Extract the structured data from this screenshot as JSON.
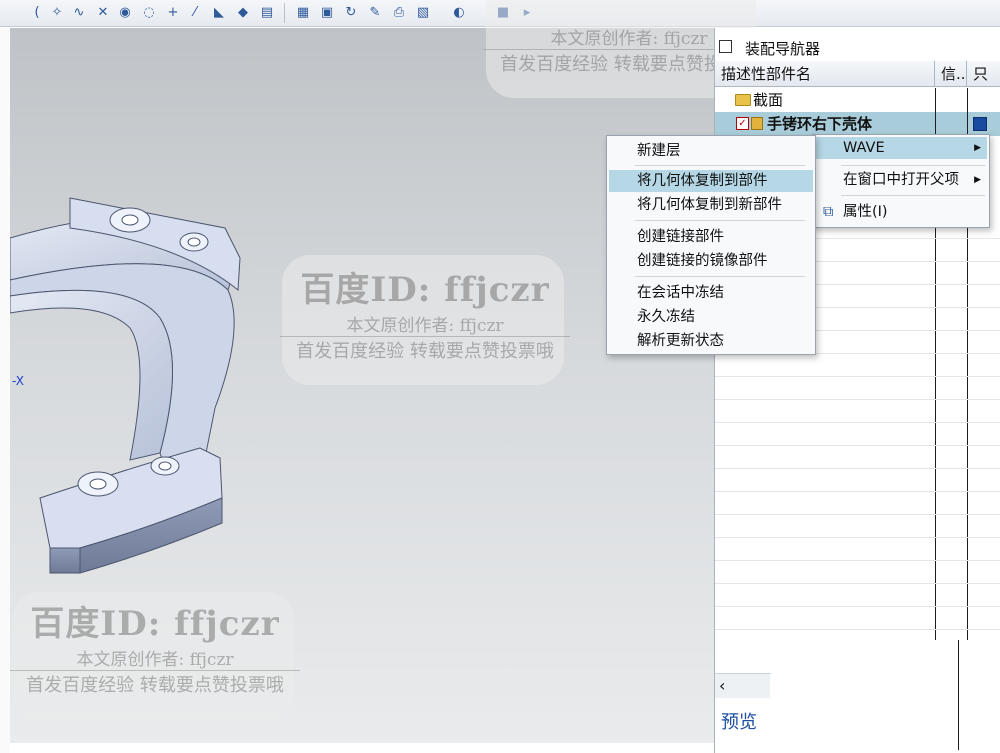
{
  "navigator": {
    "title": "装配导航器",
    "col_name": "描述性部件名",
    "col_info": "信..",
    "col_ro": "只",
    "rows": [
      {
        "label": "截面"
      },
      {
        "label": "手铐环右下壳体"
      }
    ],
    "preview": "预览"
  },
  "context_menu": {
    "items": [
      {
        "label": "新建层"
      },
      {
        "label": "将几何体复制到部件"
      },
      {
        "label": "将几何体复制到新部件"
      },
      {
        "label": "创建链接部件"
      },
      {
        "label": "创建链接的镜像部件"
      },
      {
        "label": "在会话中冻结"
      },
      {
        "label": "永久冻结"
      },
      {
        "label": "解析更新状态"
      }
    ]
  },
  "parent_menu": {
    "items": [
      {
        "label": "WAVE"
      },
      {
        "label": "在窗口中打开父项"
      },
      {
        "label": "属性(I)"
      }
    ]
  },
  "viewport": {
    "axis_label": "X"
  },
  "watermark": {
    "line1": "百度ID: ffjczr",
    "line2": "本文原创作者: ffjczr",
    "line3": "首发百度经验 转载要点赞投票哦"
  },
  "colors": {
    "selection": "#a8ccd9",
    "menu_highlight": "#b6d8e6",
    "link_blue": "#1d4fa3"
  }
}
